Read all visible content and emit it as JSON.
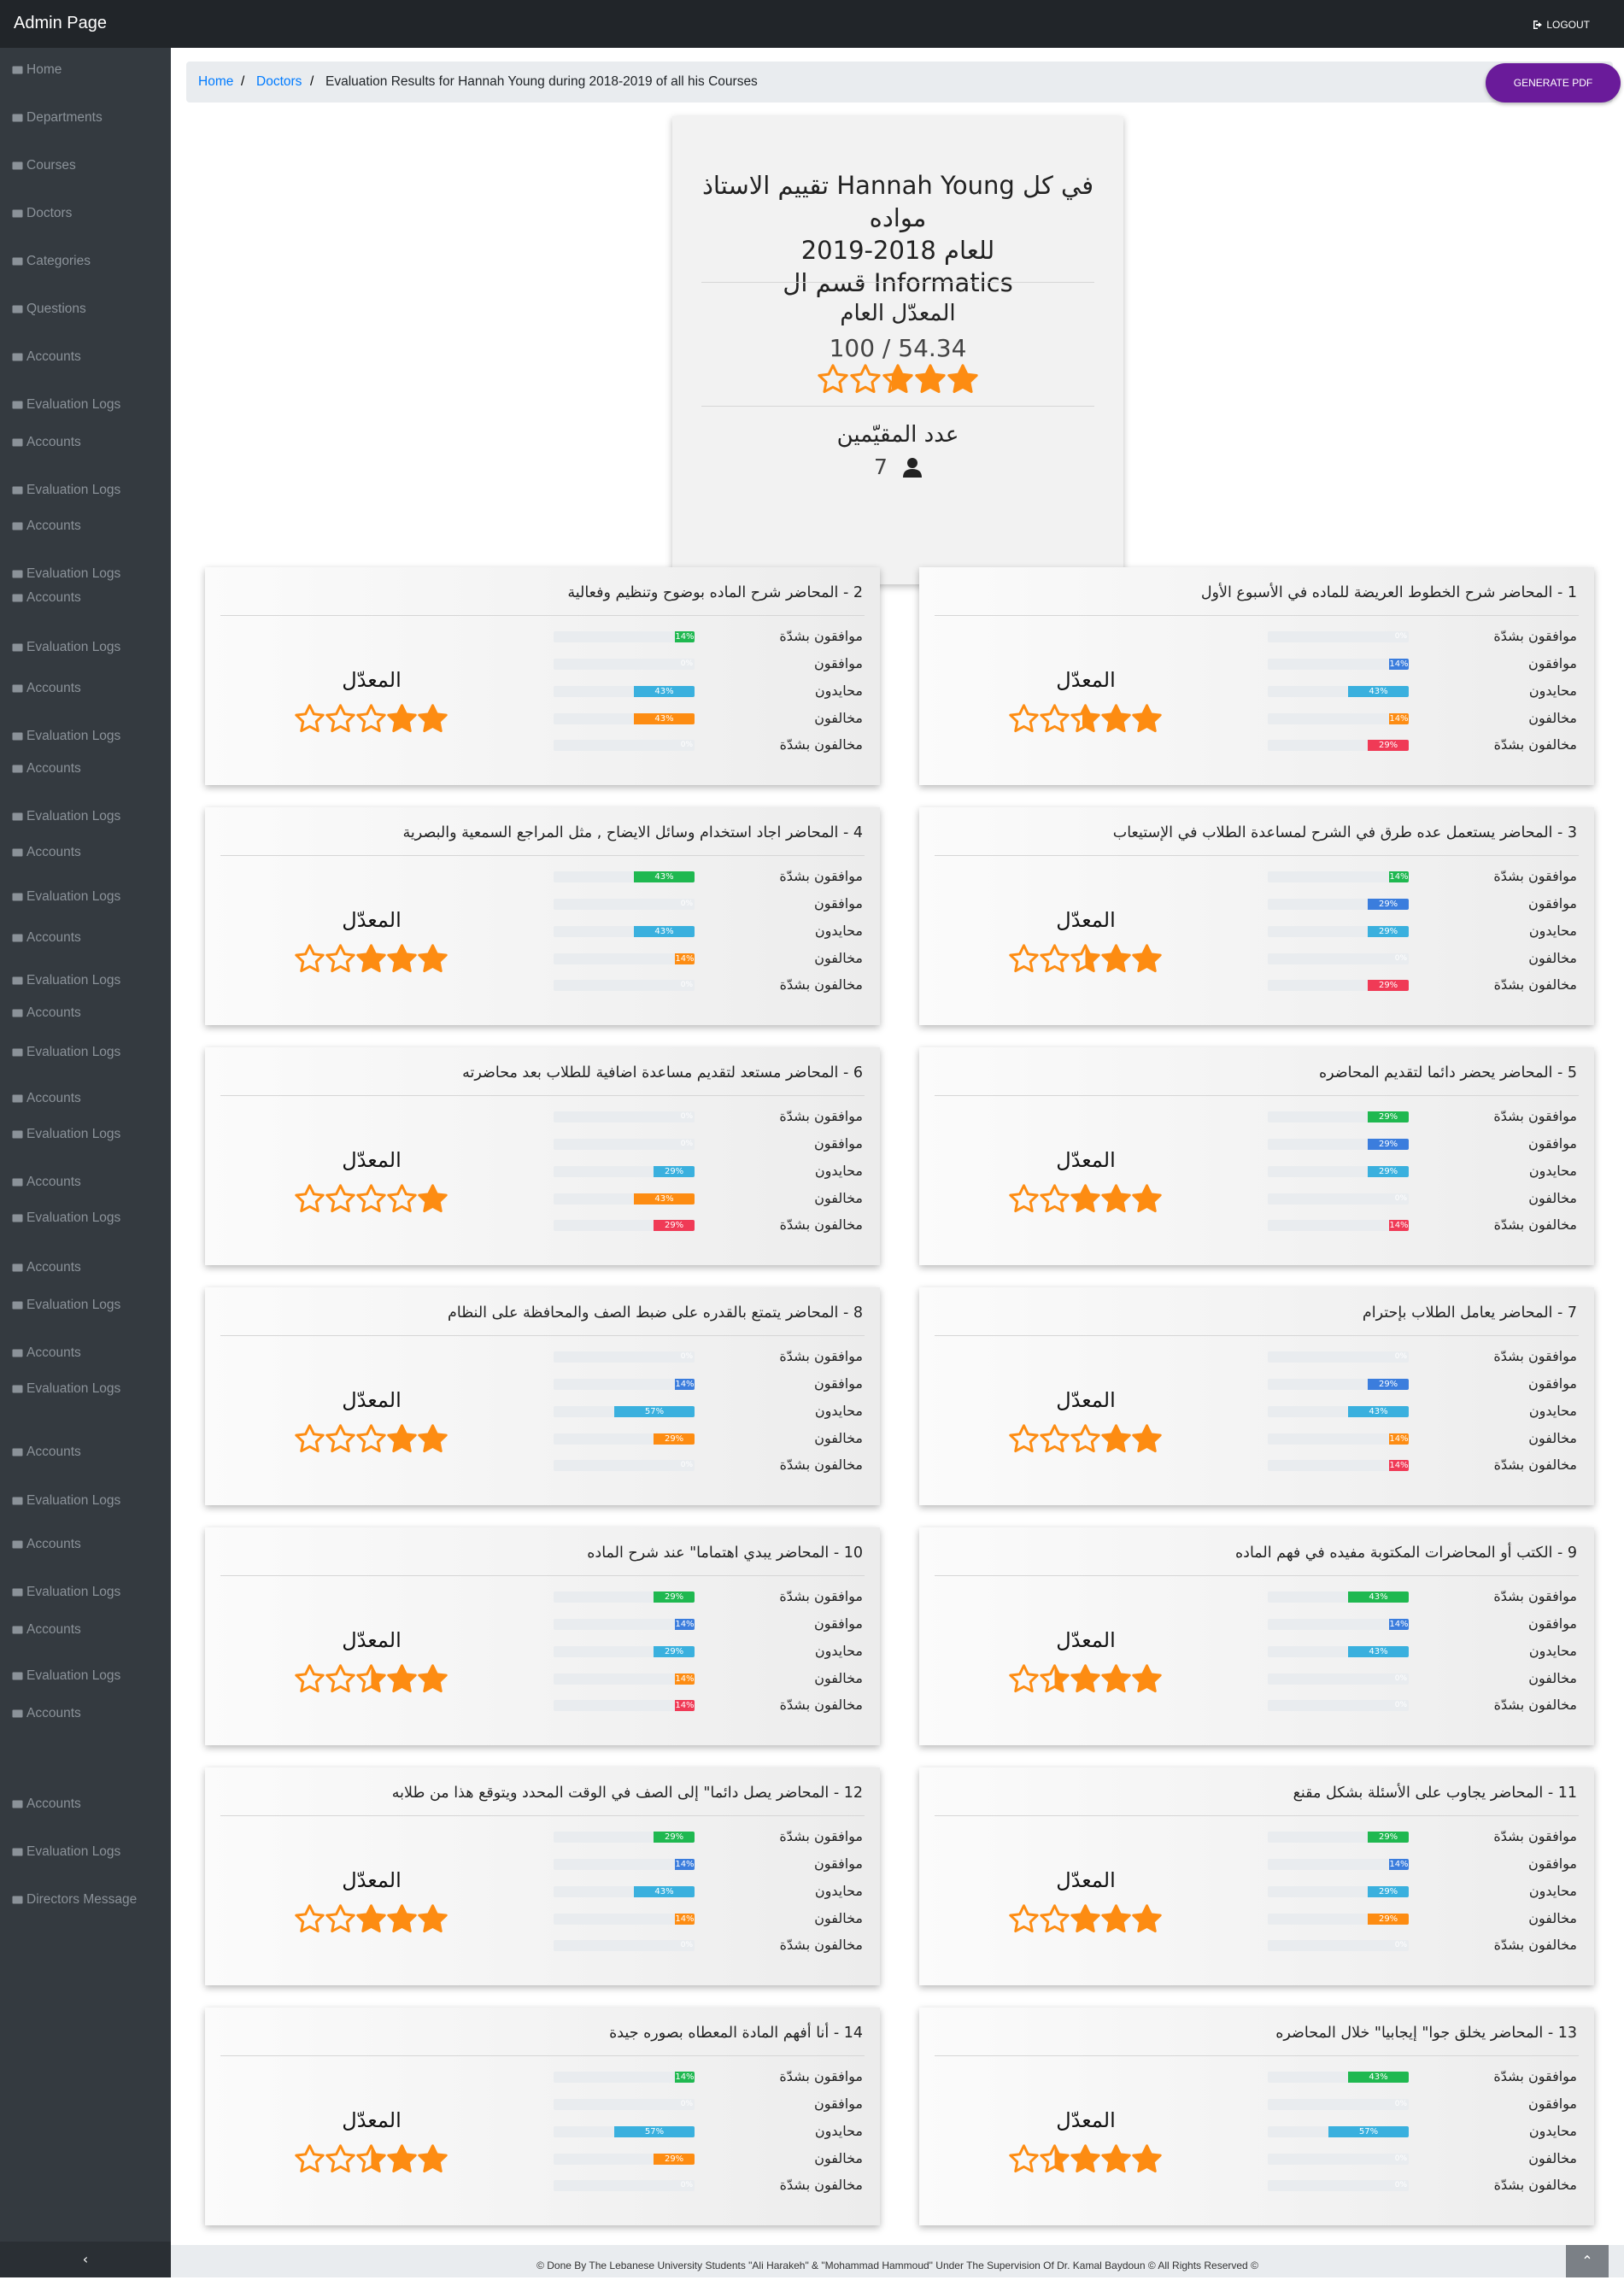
{
  "app": {
    "title": "Admin Page",
    "logout_label": "LOGOUT"
  },
  "sidebar": {
    "items": [
      {
        "label": "Home",
        "icon": "home-icon"
      },
      {
        "label": "Departments",
        "icon": "building-icon"
      },
      {
        "label": "Courses",
        "icon": "book-icon"
      },
      {
        "label": "Doctors",
        "icon": "user-icon"
      },
      {
        "label": "Categories",
        "icon": "list-icon"
      },
      {
        "label": "Questions",
        "icon": "question-icon"
      },
      {
        "label": "Accounts",
        "icon": "id-card-icon"
      },
      {
        "label": "Evaluation Logs",
        "icon": "log-icon"
      },
      {
        "label": "Accounts",
        "icon": "id-card-icon"
      },
      {
        "label": "Evaluation Logs",
        "icon": "log-icon"
      },
      {
        "label": "Accounts",
        "icon": "id-card-icon"
      },
      {
        "label": "Evaluation Logs",
        "icon": "log-icon"
      },
      {
        "label": "Accounts",
        "icon": "id-card-icon"
      },
      {
        "label": "Evaluation Logs",
        "icon": "log-icon"
      },
      {
        "label": "Accounts",
        "icon": "id-card-icon"
      },
      {
        "label": "Evaluation Logs",
        "icon": "log-icon"
      },
      {
        "label": "Accounts",
        "icon": "id-card-icon"
      },
      {
        "label": "Evaluation Logs",
        "icon": "log-icon"
      },
      {
        "label": "Accounts",
        "icon": "id-card-icon"
      },
      {
        "label": "Evaluation Logs",
        "icon": "log-icon"
      },
      {
        "label": "Accounts",
        "icon": "id-card-icon"
      },
      {
        "label": "Evaluation Logs",
        "icon": "log-icon"
      },
      {
        "label": "Accounts",
        "icon": "id-card-icon"
      },
      {
        "label": "Evaluation Logs",
        "icon": "log-icon"
      },
      {
        "label": "Accounts",
        "icon": "id-card-icon"
      },
      {
        "label": "Evaluation Logs",
        "icon": "log-icon"
      },
      {
        "label": "Accounts",
        "icon": "id-card-icon"
      },
      {
        "label": "Evaluation Logs",
        "icon": "log-icon"
      },
      {
        "label": "Accounts",
        "icon": "id-card-icon"
      },
      {
        "label": "Evaluation Logs",
        "icon": "log-icon"
      },
      {
        "label": "Accounts",
        "icon": "id-card-icon"
      },
      {
        "label": "Evaluation Logs",
        "icon": "log-icon"
      },
      {
        "label": "Accounts",
        "icon": "id-card-icon"
      },
      {
        "label": "Evaluation Logs",
        "icon": "log-icon"
      },
      {
        "label": "Accounts",
        "icon": "id-card-icon"
      },
      {
        "label": "Evaluation Logs",
        "icon": "log-icon"
      },
      {
        "label": "Accounts",
        "icon": "id-card-icon"
      },
      {
        "label": "Evaluation Logs",
        "icon": "log-icon"
      },
      {
        "label": "Accounts",
        "icon": "id-card-icon"
      },
      {
        "label": "Accounts",
        "icon": "id-card-icon"
      },
      {
        "label": "Evaluation Logs",
        "icon": "log-icon"
      },
      {
        "label": "Directors Message",
        "icon": "envelope-icon"
      }
    ],
    "collapse_icon": "‹"
  },
  "breadcrumb": {
    "home": "Home",
    "doctors": "Doctors",
    "current": "Evaluation Results for Hannah Young during 2018-2019 of all his Courses",
    "separator": "/"
  },
  "actions": {
    "generate_pdf": "GENERATE PDF"
  },
  "summary": {
    "title_line1": "تقييم الاستاذ Hannah Young في كل مواده",
    "title_line2": "للعام 2018-2019",
    "title_line3": "قسم ال Informatics",
    "average_label": "المعدّل العام",
    "average_value": "100 / 54.34",
    "average_stars": 2.7,
    "evaluators_label": "عدد المقيّمين",
    "evaluators_count": "7"
  },
  "option_labels": [
    "موافقون بشدّة",
    "موافقون",
    "محايدون",
    "مخالفون",
    "مخالفون بشدّة"
  ],
  "option_colors": [
    "#1fb850",
    "#3b7ddd",
    "#3ab0de",
    "#fd8c12",
    "#f03a56"
  ],
  "average_label": "المعدّل",
  "questions": [
    {
      "title": "1 - المحاضر شرح الخطوط العريضة للماده في الأسبوع الأول",
      "pcts": [
        0,
        14,
        43,
        14,
        29
      ],
      "stars": 2.6
    },
    {
      "title": "2 - المحاضر شرح الماده بوضوح وتنظيم وفعالية",
      "pcts": [
        14,
        0,
        43,
        43,
        0
      ],
      "stars": 2.0
    },
    {
      "title": "3 - المحاضر يستعمل عده طرق في الشرح لمساعدة الطلاب في الإستيعاب",
      "pcts": [
        14,
        29,
        29,
        0,
        29
      ],
      "stars": 2.5
    },
    {
      "title": "4 - المحاضر اجاد استخدام وسائل الايضاح , مثل المراجع السمعية والبصرية",
      "pcts": [
        43,
        0,
        43,
        14,
        0
      ],
      "stars": 3.0
    },
    {
      "title": "5 - المحاضر يحضر دائما لتقديم المحاضره",
      "pcts": [
        29,
        29,
        29,
        0,
        14
      ],
      "stars": 3.0
    },
    {
      "title": "6 - المحاضر مستعد لتقديم مساعدة اضافية للطلاب بعد محاضرته",
      "pcts": [
        0,
        0,
        29,
        43,
        29
      ],
      "stars": 1.0
    },
    {
      "title": "7 - المحاضر يعامل الطلاب بإحترام",
      "pcts": [
        0,
        29,
        43,
        14,
        14
      ],
      "stars": 2.0
    },
    {
      "title": "8 - المحاضر يتمتع بالقدره على ضبط الصف والمحافظة على النظام",
      "pcts": [
        0,
        14,
        57,
        29,
        0
      ],
      "stars": 2.0
    },
    {
      "title": "9 - الكتب أو المحاضرات المكتوبة مفيده في فهم الماده",
      "pcts": [
        43,
        14,
        43,
        0,
        0
      ],
      "stars": 3.5
    },
    {
      "title": "10 - المحاضر يبدي اهتماما\" عند شرح الماده",
      "pcts": [
        29,
        14,
        29,
        14,
        14
      ],
      "stars": 2.5
    },
    {
      "title": "11 - المحاضر يجاوب على الأسئلة بشكل مقنع",
      "pcts": [
        29,
        14,
        29,
        29,
        0
      ],
      "stars": 3.0
    },
    {
      "title": "12 - المحاضر يصل دائما\" إلى الصف في الوقت المحدد ويتوقع هذا من طلابه",
      "pcts": [
        29,
        14,
        43,
        14,
        0
      ],
      "stars": 3.0
    },
    {
      "title": "13 - المحاضر يخلق جوا\" إيجابيا\" خلال المحاضره",
      "pcts": [
        43,
        0,
        57,
        0,
        0
      ],
      "stars": 3.5
    },
    {
      "title": "14 - أنا أفهم المادة المعطاه بصوره جيدة",
      "pcts": [
        14,
        0,
        57,
        29,
        0
      ],
      "stars": 2.5
    }
  ],
  "footer": {
    "text": "© Done By The Lebanese University Students \"Ali Harakeh\" & \"Mohammad Hammoud\" Under The Supervision Of Dr. Kamal Baydoun © All Rights Reserved ©",
    "scroll_top_icon": "⌃"
  }
}
